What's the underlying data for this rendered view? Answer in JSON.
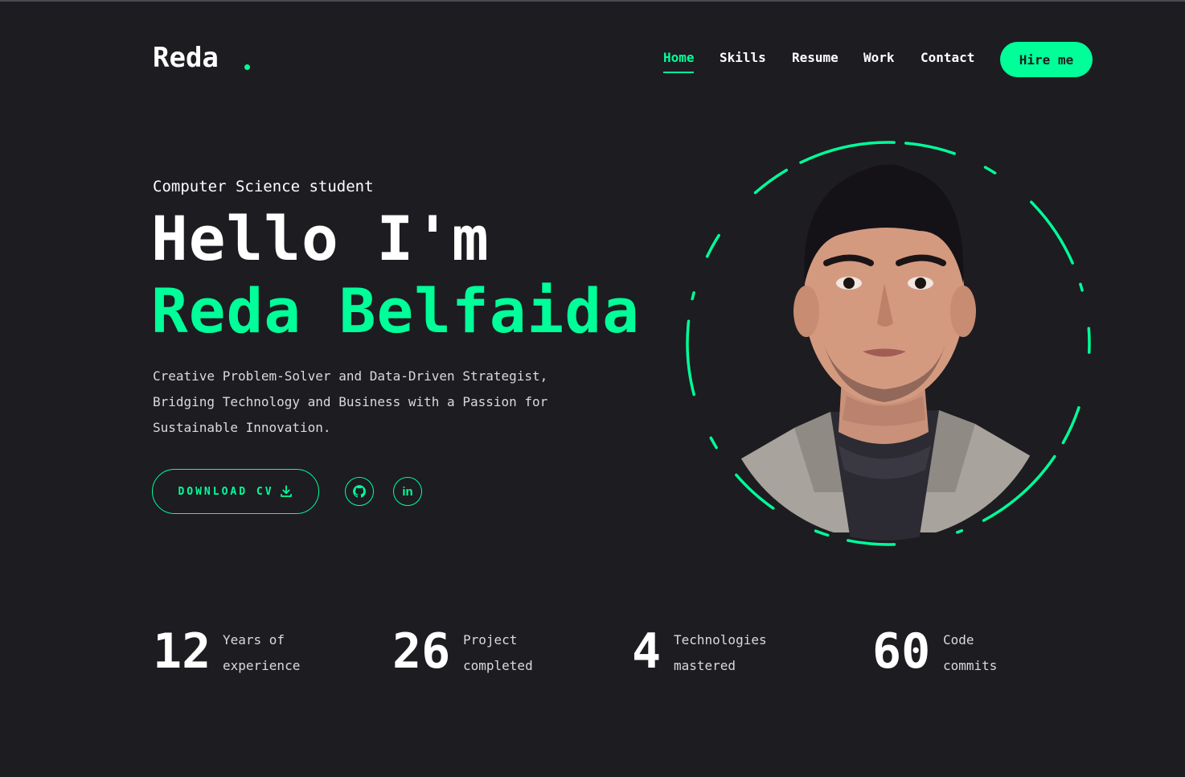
{
  "header": {
    "logo": "Reda",
    "nav": [
      {
        "label": "Home",
        "active": true
      },
      {
        "label": "Skills",
        "active": false
      },
      {
        "label": "Resume",
        "active": false
      },
      {
        "label": "Work",
        "active": false
      },
      {
        "label": "Contact",
        "active": false
      }
    ],
    "hire_label": "Hire me"
  },
  "hero": {
    "subtitle": "Computer Science student",
    "greeting": "Hello I'm",
    "name": "Reda Belfaida",
    "description_lines": [
      "Creative Problem-Solver and Data-Driven Strategist,",
      "Bridging Technology and Business with a Passion for",
      "Sustainable Innovation."
    ],
    "cv_label": "DOWNLOAD CV",
    "cv_icon": "download-icon",
    "socials": [
      {
        "icon": "github-icon"
      },
      {
        "icon": "linkedin-icon",
        "text": "in"
      }
    ]
  },
  "stats": [
    {
      "number": "12",
      "label_lines": [
        "Years of",
        "experience"
      ]
    },
    {
      "number": "26",
      "label_lines": [
        "Project",
        "completed"
      ]
    },
    {
      "number": "4",
      "label_lines": [
        "Technologies",
        "mastered"
      ]
    },
    {
      "number": "60",
      "label_lines": [
        "Code",
        "commits"
      ]
    }
  ],
  "colors": {
    "accent": "#00ff99",
    "background": "#1d1c21",
    "text": "#ffffff"
  }
}
